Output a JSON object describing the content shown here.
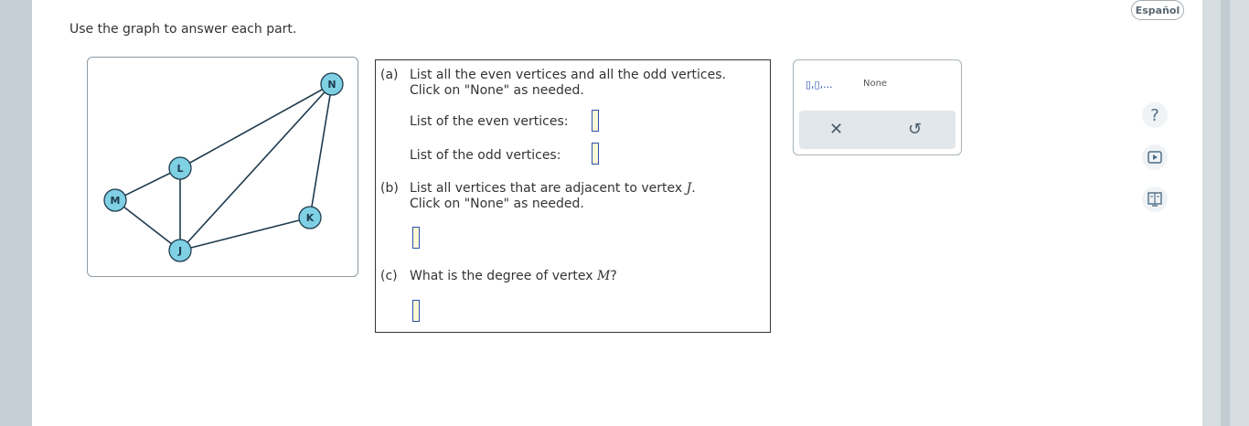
{
  "instructions": "Use the graph to answer each part.",
  "graph": {
    "vertices": [
      {
        "id": "N",
        "label": "N"
      },
      {
        "id": "L",
        "label": "L"
      },
      {
        "id": "M",
        "label": "M"
      },
      {
        "id": "K",
        "label": "K"
      },
      {
        "id": "J",
        "label": "J"
      }
    ],
    "edges": [
      [
        "M",
        "L"
      ],
      [
        "M",
        "J"
      ],
      [
        "L",
        "J"
      ],
      [
        "L",
        "N"
      ],
      [
        "J",
        "N"
      ],
      [
        "N",
        "K"
      ],
      [
        "J",
        "K"
      ]
    ]
  },
  "question": {
    "a": {
      "tag": "(a)",
      "prompt_line1": "List all the even vertices and all the odd vertices.",
      "prompt_line2": "Click on \"None\" as needed.",
      "even_label": "List of the even vertices:",
      "odd_label": "List of the odd vertices:"
    },
    "b": {
      "tag": "(b)",
      "prompt_prefix": "List all vertices that are adjacent to vertex ",
      "prompt_var": "J",
      "prompt_suffix": ".",
      "prompt_line2": "Click on \"None\" as needed."
    },
    "c": {
      "tag": "(c)",
      "prompt_prefix": "What is the degree of vertex ",
      "prompt_var": "M",
      "prompt_suffix": "?"
    }
  },
  "palette": {
    "list_label": "▯,▯,...",
    "none_label": "None",
    "clear_icon": "close-icon",
    "undo_icon": "undo-icon"
  },
  "language_button": "Español",
  "side_icons": [
    "help-icon",
    "video-icon",
    "textbook-icon"
  ],
  "help_glyph": "?"
}
